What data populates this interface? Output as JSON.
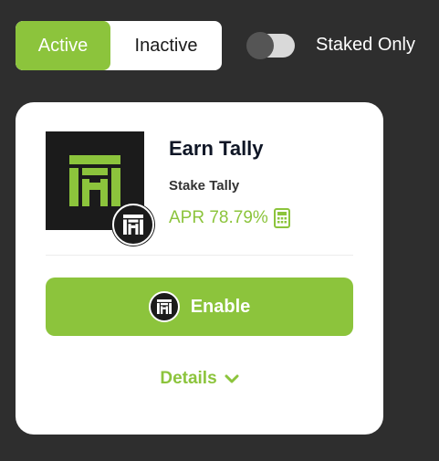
{
  "filter": {
    "active_label": "Active",
    "inactive_label": "Inactive",
    "selected": "Active"
  },
  "staked_only": {
    "label": "Staked Only",
    "enabled": false
  },
  "pool": {
    "title": "Earn Tally",
    "subtitle": "Stake Tally",
    "apr": "APR 78.79%",
    "enable_label": "Enable",
    "details_label": "Details"
  },
  "colors": {
    "accent": "#8cc43c",
    "background": "#2e2e2e",
    "card": "#ffffff",
    "logo_bg": "#1b1b1b"
  },
  "icons": {
    "logo": "tally-logo-icon",
    "calculator": "calculator-icon",
    "chevron": "chevron-down-icon"
  }
}
